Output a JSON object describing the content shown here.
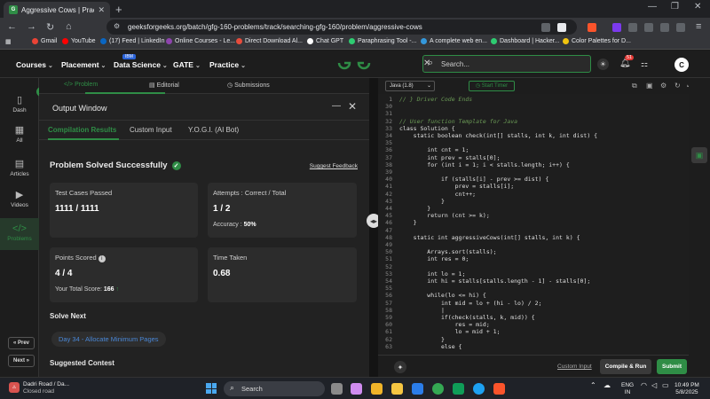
{
  "browser": {
    "tab_title": "Aggressive Cows | Practice | Ge",
    "url": "geeksforgeeks.org/batch/gfg-160-problems/track/searching-gfg-160/problem/aggressive-cows",
    "bookmarks": [
      "Gmail",
      "YouTube",
      "(17) Feed | LinkedIn",
      "Online Courses - Le...",
      "Direct Download Al...",
      "Chat GPT",
      "Paraphrasing Tool -...",
      "A complete web en...",
      "Dashboard | Hacker...",
      "Color Palettes for D..."
    ],
    "bookmark_colors": [
      "#ea4335",
      "#ff0000",
      "#0a66c2",
      "#8e44ad",
      "#e74c3c",
      "#ffffff",
      "#2ecc71",
      "#3498db",
      "#2ecc71",
      "#f1c40f"
    ]
  },
  "gfg_nav": {
    "items": [
      "Courses",
      "Placement",
      "Data Science",
      "GATE",
      "Practice"
    ],
    "ibm_badge": "IBM",
    "logo": "GfG",
    "search_placeholder": "Search...",
    "notification_count": "51",
    "avatar_letter": "C"
  },
  "sidebar": {
    "items": [
      "Dash",
      "All",
      "Articles",
      "Videos",
      "Problems"
    ],
    "prev": "« Prev",
    "next": "Next »"
  },
  "problem_tabs": [
    "Problem",
    "Editorial",
    "Submissions"
  ],
  "output": {
    "title": "Output Window",
    "tabs": [
      "Compilation Results",
      "Custom Input",
      "Y.O.G.I. (AI Bot)"
    ],
    "status": "Problem Solved Successfully",
    "feedback": "Suggest Feedback",
    "test_cases_label": "Test Cases Passed",
    "test_cases_value": "1111 / 1111",
    "attempts_label": "Attempts : Correct / Total",
    "attempts_value": "1 / 2",
    "accuracy_label": "Accuracy :",
    "accuracy_value": "50%",
    "points_label": "Points Scored",
    "points_value": "4 / 4",
    "total_score_label": "Your Total Score:",
    "total_score_value": "166",
    "time_label": "Time Taken",
    "time_value": "0.68",
    "solve_next": "Solve Next",
    "next_problem": "Day 34 - Allocate Minimum Pages",
    "suggested": "Suggested Contest"
  },
  "editor": {
    "language": "Java (1.8)",
    "timer": "Start Timer",
    "custom_input": "Custom Input",
    "compile": "Compile & Run",
    "submit": "Submit",
    "lines": [
      {
        "n": "1",
        "t": "// } Driver Code Ends",
        "c": "cm"
      },
      {
        "n": "30",
        "t": ""
      },
      {
        "n": "31",
        "t": ""
      },
      {
        "n": "32",
        "t": "// User function Template for Java",
        "c": "cm"
      },
      {
        "n": "33",
        "t": "class Solution {"
      },
      {
        "n": "34",
        "t": "    static boolean check(int[] stalls, int k, int dist) {"
      },
      {
        "n": "35",
        "t": ""
      },
      {
        "n": "36",
        "t": "        int cnt = 1;"
      },
      {
        "n": "37",
        "t": "        int prev = stalls[0];"
      },
      {
        "n": "38",
        "t": "        for (int i = 1; i < stalls.length; i++) {"
      },
      {
        "n": "39",
        "t": ""
      },
      {
        "n": "40",
        "t": "            if (stalls[i] - prev >= dist) {"
      },
      {
        "n": "41",
        "t": "                prev = stalls[i];"
      },
      {
        "n": "42",
        "t": "                cnt++;"
      },
      {
        "n": "43",
        "t": "            }"
      },
      {
        "n": "44",
        "t": "        }"
      },
      {
        "n": "45",
        "t": "        return (cnt >= k);"
      },
      {
        "n": "46",
        "t": "    }"
      },
      {
        "n": "47",
        "t": ""
      },
      {
        "n": "48",
        "t": "    static int aggressiveCows(int[] stalls, int k) {"
      },
      {
        "n": "49",
        "t": ""
      },
      {
        "n": "50",
        "t": "        Arrays.sort(stalls);"
      },
      {
        "n": "51",
        "t": "        int res = 0;"
      },
      {
        "n": "52",
        "t": ""
      },
      {
        "n": "53",
        "t": "        int lo = 1;"
      },
      {
        "n": "54",
        "t": "        int hi = stalls[stalls.length - 1] - stalls[0];"
      },
      {
        "n": "55",
        "t": ""
      },
      {
        "n": "56",
        "t": "        while(lo <= hi) {"
      },
      {
        "n": "57",
        "t": "            int mid = lo + (hi - lo) / 2;"
      },
      {
        "n": "58",
        "t": "            |"
      },
      {
        "n": "59",
        "t": "            if(check(stalls, k, mid)) {"
      },
      {
        "n": "60",
        "t": "                res = mid;"
      },
      {
        "n": "61",
        "t": "                lo = mid + 1;"
      },
      {
        "n": "62",
        "t": "            }"
      },
      {
        "n": "63",
        "t": "            else {"
      }
    ]
  },
  "taskbar": {
    "weather_line1": "Dadri Road / Da...",
    "weather_line2": "Closed road",
    "search": "Search",
    "lang1": "ENG",
    "lang2": "IN",
    "time": "10:49 PM",
    "date": "5/8/2025"
  }
}
